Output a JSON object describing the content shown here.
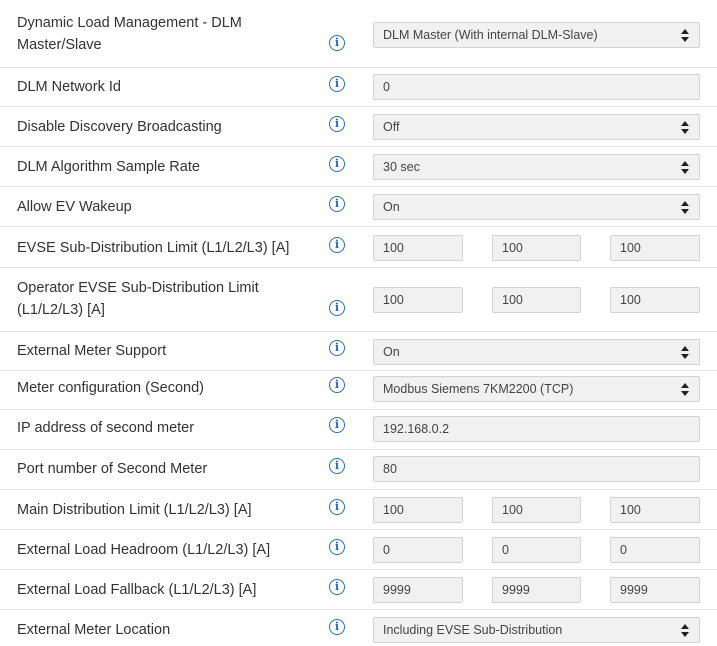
{
  "rows": [
    {
      "label": "Dynamic Load Management - DLM Master/Slave",
      "value": "DLM Master (With internal DLM-Slave)"
    },
    {
      "label": "DLM Network Id",
      "value": "0"
    },
    {
      "label": "Disable Discovery Broadcasting",
      "value": "Off"
    },
    {
      "label": "DLM Algorithm Sample Rate",
      "value": "30 sec"
    },
    {
      "label": "Allow EV Wakeup",
      "value": "On"
    },
    {
      "label": "EVSE Sub-Distribution Limit (L1/L2/L3) [A]",
      "values": [
        "100",
        "100",
        "100"
      ]
    },
    {
      "label": "Operator EVSE Sub-Distribution Limit (L1/L2/L3) [A]",
      "values": [
        "100",
        "100",
        "100"
      ]
    },
    {
      "label": "External Meter Support",
      "value": "On"
    },
    {
      "label": "Meter configuration (Second)",
      "value": "Modbus Siemens 7KM2200 (TCP)"
    },
    {
      "label": "IP address of second meter",
      "value": "192.168.0.2"
    },
    {
      "label": "Port number of Second Meter",
      "value": "80"
    },
    {
      "label": "Main Distribution Limit (L1/L2/L3) [A]",
      "values": [
        "100",
        "100",
        "100"
      ]
    },
    {
      "label": "External Load Headroom (L1/L2/L3) [A]",
      "values": [
        "0",
        "0",
        "0"
      ]
    },
    {
      "label": "External Load Fallback (L1/L2/L3) [A]",
      "values": [
        "9999",
        "9999",
        "9999"
      ]
    },
    {
      "label": "External Meter Location",
      "value": "Including EVSE Sub-Distribution"
    }
  ],
  "info_icon_glyph": "i",
  "colors": {
    "info_icon": "#2a6ebb",
    "field_bg": "#f1f1f1",
    "field_border": "#d3d3d3",
    "row_divider": "#e4e4e4"
  }
}
